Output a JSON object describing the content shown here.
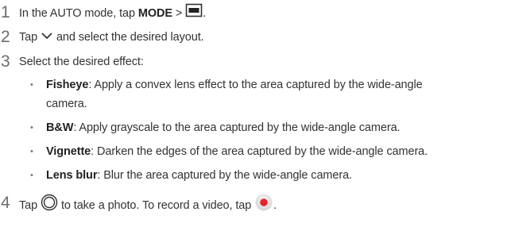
{
  "steps": [
    {
      "num": "1",
      "text_a": "In the AUTO mode, tap ",
      "bold_a": "MODE",
      "text_b": " > ",
      "text_c": "."
    },
    {
      "num": "2",
      "text_a": "Tap ",
      "text_b": " and select the desired layout."
    },
    {
      "num": "3",
      "text_a": "Select the desired effect:"
    },
    {
      "num": "4",
      "text_a": "Tap ",
      "text_b": " to take a photo. To record a video, tap ",
      "text_c": "."
    }
  ],
  "effects": [
    {
      "name": "Fisheye",
      "desc": ": Apply a convex lens effect to the area captured by the wide-angle",
      "desc_cont": "camera."
    },
    {
      "name": "B&W",
      "desc": ": Apply grayscale to the area captured by the wide-angle camera."
    },
    {
      "name": "Vignette",
      "desc": ": Darken the edges of the area captured by the wide-angle camera."
    },
    {
      "name": "Lens blur",
      "desc": ": Blur the area captured by the wide-angle camera."
    }
  ],
  "bullet_char": "•",
  "icons": {
    "mode_layout": "layout-icon",
    "chevron": "chevron-down-icon",
    "shutter": "shutter-icon",
    "record": "record-icon"
  },
  "colors": {
    "record_red": "#e5242a",
    "text": "#333333"
  }
}
